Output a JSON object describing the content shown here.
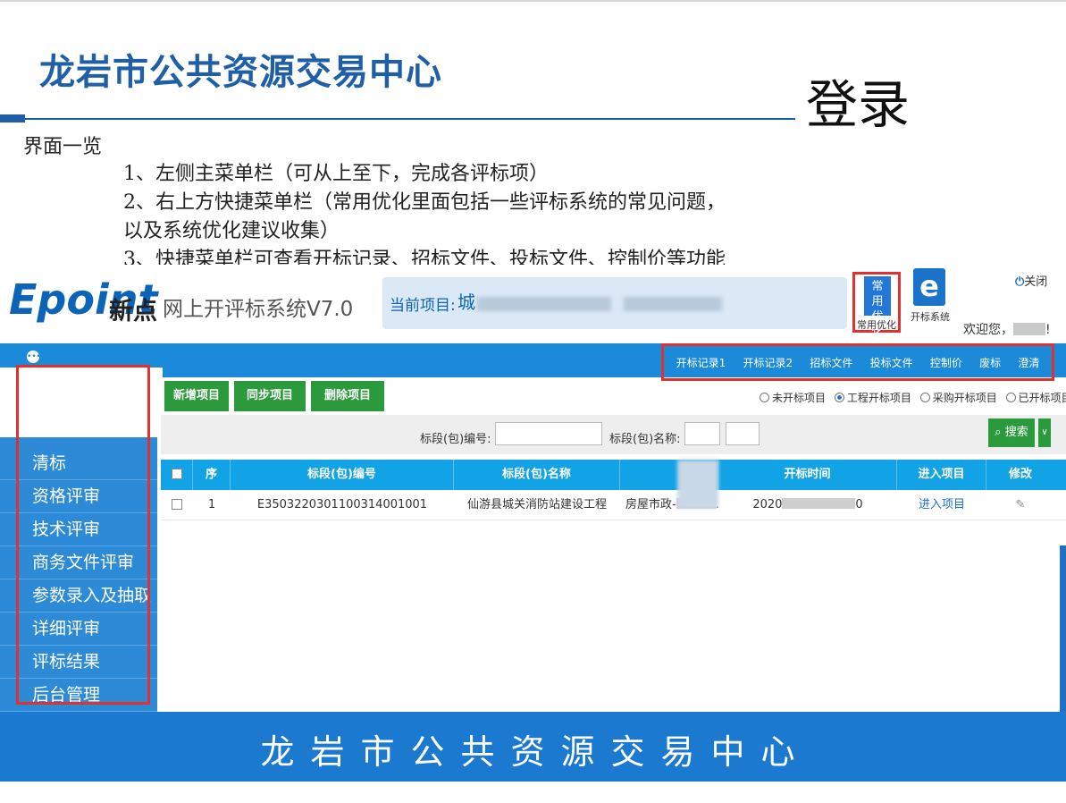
{
  "slide": {
    "title": "龙岩市公共资源交易中心",
    "section": "登录",
    "overview_heading": "界面一览",
    "bullets": [
      "1、左侧主菜单栏（可从上至下，完成各评标项）",
      "2、右上方快捷菜单栏（常用优化里面包括一些评标系统的常见问题，",
      "以及系统优化建议收集）",
      "3、快捷菜单栏可查看开标记录、招标文件、投标文件、控制价等功能"
    ],
    "footer": "龙岩市公共资源交易中心"
  },
  "app": {
    "logo": "Epoint",
    "logo_cn": "新点",
    "system_name": "网上开评标系统V7.0",
    "current_project_label": "当前项目:",
    "current_project_value": "城",
    "quick_opt_text": "常 用 优 化",
    "quick_opt_label": "常用优化",
    "open_system_label": "开标系统",
    "open_system_icon": "e",
    "welcome": "欢迎您，",
    "welcome_tail": "!",
    "close_label": "关闭",
    "quick_menu": [
      "开标记录1",
      "开标记录2",
      "招标文件",
      "投标文件",
      "控制价",
      "废标",
      "澄清"
    ],
    "sidebar": [
      "清标",
      "资格评审",
      "技术评审",
      "商务文件评审",
      "参数录入及抽取",
      "详细评审",
      "评标结果",
      "后台管理"
    ],
    "toolbar": [
      "新增项目",
      "同步项目",
      "删除项目"
    ],
    "radios": [
      {
        "label": "未开标项目",
        "checked": false
      },
      {
        "label": "工程开标项目",
        "checked": true
      },
      {
        "label": "采购开标项目",
        "checked": false
      },
      {
        "label": "已开标项目",
        "checked": false
      }
    ],
    "search": {
      "code_label": "标段(包)编号:",
      "code_value": "",
      "name_label": "标段(包)名称:",
      "name_value": "",
      "button": "搜索",
      "search_icon": "search-icon"
    },
    "table": {
      "headers": [
        "序",
        "标段(包)编号",
        "标段(包)名称",
        "",
        "开标时间",
        "进入项目",
        "修改"
      ],
      "rows": [
        {
          "index": "1",
          "code": "E3503220301100314001001",
          "name": "仙游县城关消防站建设工程",
          "type": "房屋市政-",
          "type_tail": ".",
          "time": "2020",
          "time_tail": "0",
          "enter": "进入项目",
          "edit_icon": "pencil-icon"
        }
      ]
    }
  }
}
